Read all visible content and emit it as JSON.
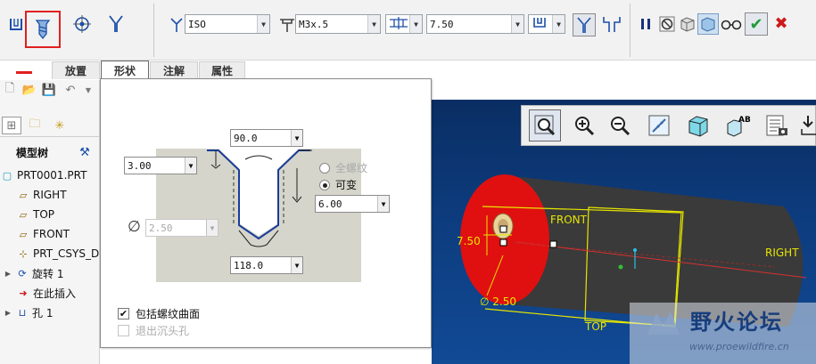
{
  "dashboard": {
    "thread_standard": "ISO",
    "screw_size": "M3x.5",
    "depth_value": "7.50",
    "icons": [
      "straight-hole-icon",
      "standard-hole-icon",
      "sketch-hole-icon",
      "tapped-icon",
      "thread-standard-icon",
      "screw-size-icon",
      "depth-type-icon",
      "depth-option-icon",
      "countersink-icon",
      "counterbore-icon",
      "pause-icon",
      "no-preview-icon",
      "preview-icon",
      "verify-icon",
      "glasses-icon",
      "confirm-icon",
      "cancel-icon"
    ]
  },
  "tabs": [
    "放置",
    "形状",
    "注解",
    "属性"
  ],
  "active_tab": "形状",
  "model_tree": {
    "header": "模型树",
    "items": [
      "PRT0001.PRT",
      "RIGHT",
      "TOP",
      "FRONT",
      "PRT_CSYS_D",
      "旋转 1",
      "在此插入",
      "孔 1"
    ]
  },
  "shape": {
    "countersink_angle": "90.0",
    "thread_depth": "3.00",
    "diameter": "2.50",
    "tip_angle": "118.0",
    "hole_depth": "6.00",
    "radio_full_thread": "全螺纹",
    "radio_variable": "可变",
    "include_thread_surface": "包括螺纹曲面",
    "exit_countersink": "退出沉头孔",
    "diameter_symbol": "∅"
  },
  "viewport": {
    "labels": {
      "front": "FRONT",
      "top": "TOP",
      "right": "RIGHT",
      "depth_dim": "7.50",
      "diameter_dim": "∅ 2.50"
    },
    "colors": {
      "end_face": "#e01010",
      "cylinder": "#3c3c3c",
      "datum": "#e6e600",
      "background": "#0d3c7e"
    }
  },
  "watermark": {
    "title": "野火论坛",
    "url": "www.proewildfire.cn"
  }
}
